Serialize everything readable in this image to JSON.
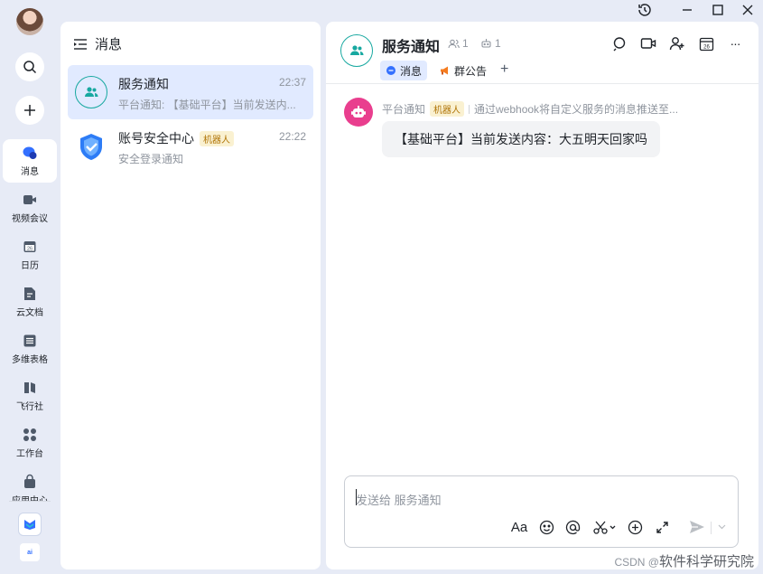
{
  "window": {
    "history_icon": "history-icon",
    "minimize_icon": "minimize-icon",
    "maximize_icon": "maximize-icon",
    "close_icon": "close-icon"
  },
  "rail": {
    "items": [
      {
        "label": "消息",
        "icon": "chat-bubble-icon",
        "active": true
      },
      {
        "label": "视频会议",
        "icon": "video-icon"
      },
      {
        "label": "日历",
        "icon": "calendar-icon"
      },
      {
        "label": "云文档",
        "icon": "document-icon"
      },
      {
        "label": "多维表格",
        "icon": "table-icon"
      },
      {
        "label": "飞行社",
        "icon": "book-icon"
      },
      {
        "label": "工作台",
        "icon": "grid-icon"
      },
      {
        "label": "应用中心",
        "icon": "bag-icon"
      }
    ],
    "bottom_logo_text": "ai"
  },
  "list": {
    "title": "消息",
    "conversations": [
      {
        "title": "服务通知",
        "time": "22:37",
        "preview": "平台通知: 【基础平台】当前发送内...",
        "active": true
      },
      {
        "title": "账号安全中心",
        "badge": "机器人",
        "time": "22:22",
        "preview": "安全登录通知"
      }
    ]
  },
  "chat": {
    "title": "服务通知",
    "members_count": "1",
    "bots_count": "1",
    "tabs": [
      {
        "label": "消息"
      },
      {
        "label": "群公告"
      }
    ],
    "add_tab": "+",
    "more": "···",
    "message": {
      "sender": "平台通知",
      "sender_badge": "机器人",
      "source": "通过webhook将自定义服务的消息推送至...",
      "text": "【基础平台】当前发送内容：大五明天回家吗"
    },
    "composer": {
      "placeholder": "发送给 服务通知",
      "font_label": "Aa"
    }
  },
  "watermark": {
    "prefix": "CSDN @",
    "text": "软件科学研究院"
  },
  "colors": {
    "accent": "#3370ff",
    "teal": "#17a8a0",
    "bot_pink": "#e93e8e",
    "badge_bg": "#faf1d1",
    "badge_text": "#b07406",
    "selected": "#e1eaff"
  }
}
